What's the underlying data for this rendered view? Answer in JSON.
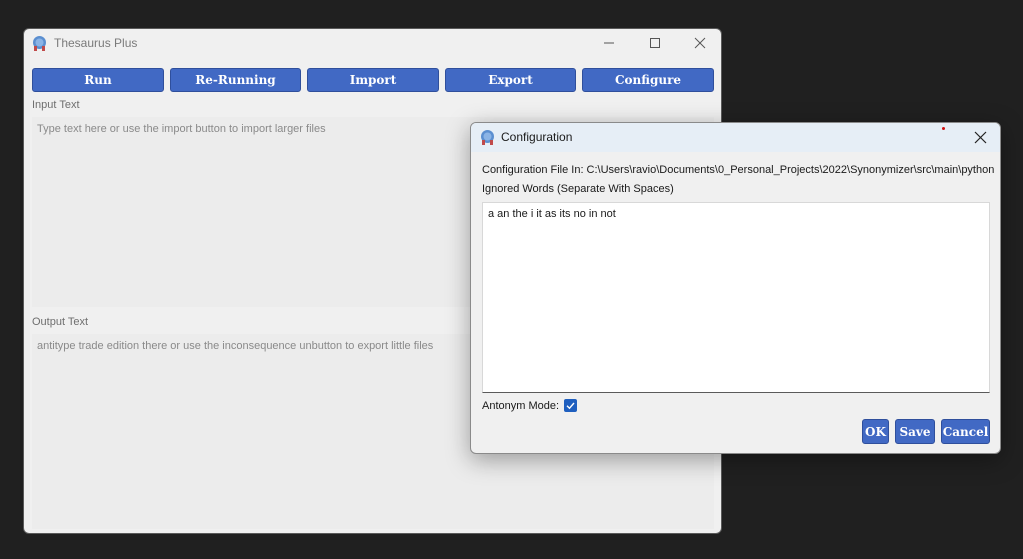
{
  "main_window": {
    "title": "Thesaurus Plus",
    "toolbar": {
      "run": "Run",
      "rerun": "Re-Running",
      "import": "Import",
      "export": "Export",
      "configure": "Configure"
    },
    "input_label": "Input Text",
    "input_placeholder": "Type text here or use the import button to import larger files",
    "output_label": "Output Text",
    "output_text": "antitype trade edition there or use the inconsequence unbutton to export little files"
  },
  "dialog": {
    "title": "Configuration",
    "config_file_text": "Configuration File In: C:\\Users\\ravio\\Documents\\0_Personal_Projects\\2022\\Synonymizer\\src\\main\\python",
    "ignored_words_label": "Ignored Words (Separate With Spaces)",
    "ignored_words_value": "a an the i it as its no in not",
    "antonym_mode_label": "Antonym Mode:",
    "antonym_mode_checked": true,
    "buttons": {
      "ok": "OK",
      "save": "Save",
      "cancel": "Cancel"
    }
  },
  "colors": {
    "button": "#4169c4",
    "checkbox": "#1f5fbf",
    "desktop": "#202020"
  }
}
